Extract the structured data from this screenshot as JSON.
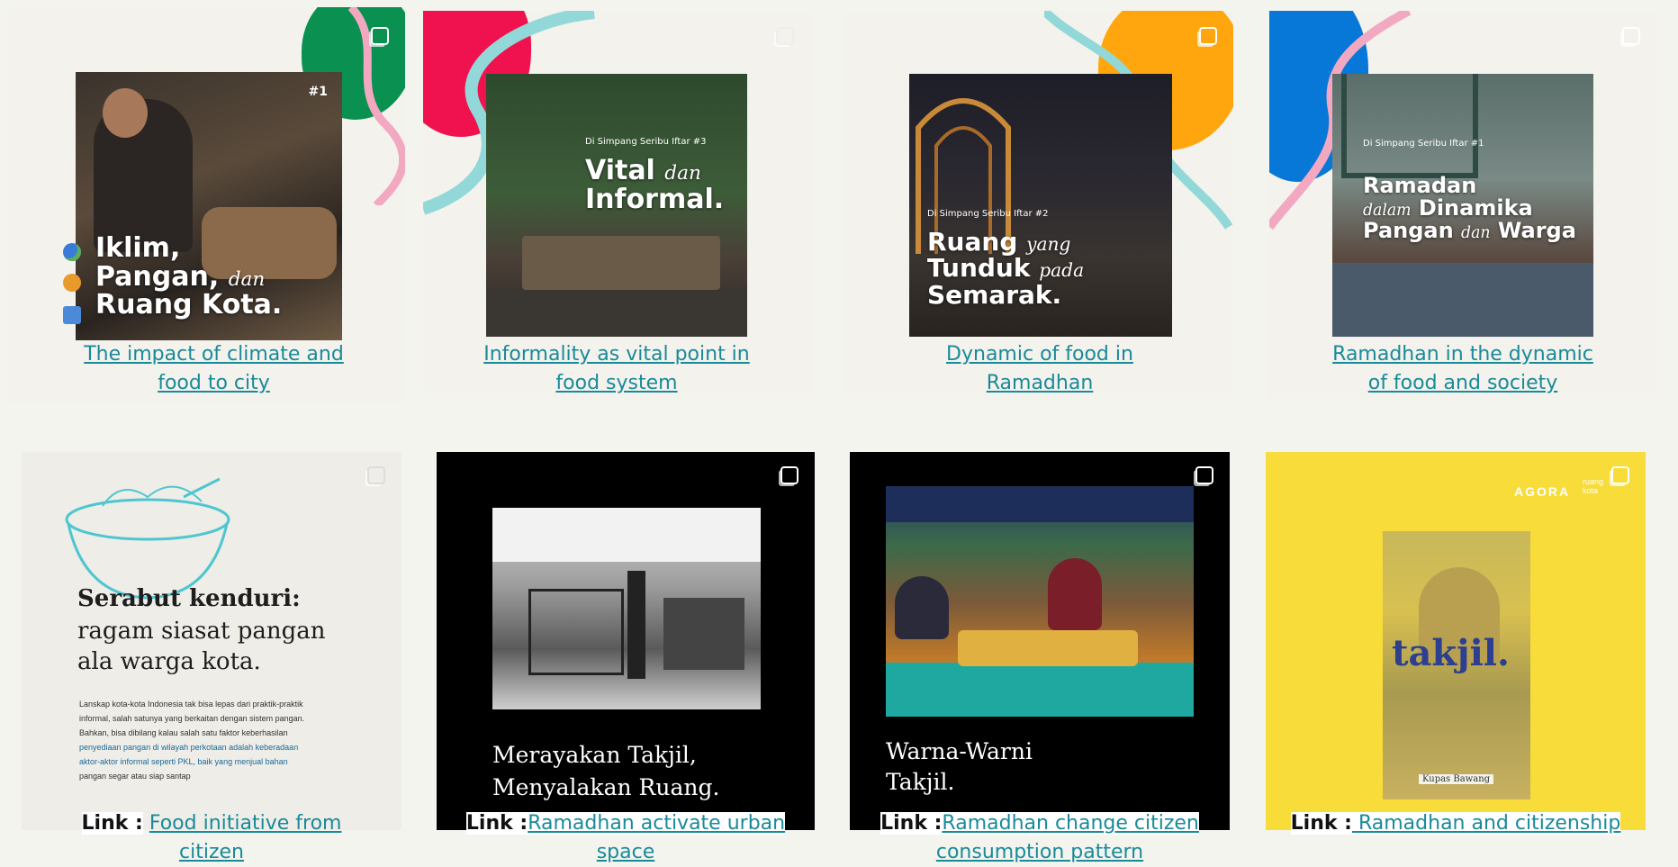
{
  "row1": [
    {
      "badge": "#1",
      "lines": [
        "Iklim,",
        "Pangan,",
        "Ruang Kota."
      ],
      "italic": "dan",
      "caption_l1": "The impact of climate and",
      "caption_l2": "food to city"
    },
    {
      "kicker": "Di Simpang Seribu Iftar #3",
      "line1": "Vital",
      "italic": "dan",
      "line2": "Informal.",
      "caption_l1": "Informality as vital point in",
      "caption_l2": "food system"
    },
    {
      "kicker": "Di Simpang Seribu Iftar #2",
      "line1": "Ruang",
      "italic1": "yang",
      "line2": "Tunduk",
      "italic2": "pada",
      "line3": "Semarak.",
      "caption_l1": "Dynamic of food  in",
      "caption_l2": "Ramadhan"
    },
    {
      "kicker": "Di Simpang Seribu Iftar #1",
      "line1": "Ramadan",
      "italic1": "dalam",
      "line2": "Dinamika",
      "line3": "Pangan",
      "italic2": "dan",
      "line4": "Warga",
      "caption_l1": "Ramadhan in the dynamic",
      "caption_l2": "of food and society"
    }
  ],
  "row2": [
    {
      "title": "Serabut kenduri:",
      "subtitle1": "ragam siasat pangan",
      "subtitle2": "ala warga kota.",
      "body": [
        "Lanskap kota-kota Indonesia tak bisa lepas dari praktik-praktik",
        "informal, salah satunya yang berkaitan dengan sistem pangan.",
        "Bahkan, bisa dibilang kalau salah satu faktor keberhasilan",
        "penyediaan pangan di wilayah perkotaan adalah keberadaan",
        "aktor-aktor informal seperti PKL, baik yang menjual bahan",
        "pangan segar atau siap santap"
      ],
      "link_label": "Link :",
      "link_l1": "Food initiative from",
      "link_l2": "citizen"
    },
    {
      "line1": "Merayakan Takjil,",
      "line2": "Menyalakan Ruang.",
      "link_label": "Link :",
      "link_l1": "Ramadhan activate urban",
      "link_l2": "space"
    },
    {
      "line1": "Warna-Warni",
      "line2": "Takjil.",
      "link_label": "Link :",
      "link_l1": "Ramadhan change citizen",
      "link_l2": "consumption pattern"
    },
    {
      "brand": "AGORA",
      "brand2": "ruang kota",
      "title": "takjil.",
      "tag": "Kupas Bawang",
      "link_label": "Link :",
      "link_l1": " Ramadhan and citizenship"
    }
  ],
  "colors": {
    "link": "#1a8a99",
    "green_blob": "#0a9050",
    "red_blob": "#f0124f",
    "orange_blob": "#ffa60f",
    "blue_blob": "#0878d8",
    "teal_stroke": "#92d8d8",
    "pink_stroke": "#f2a8c0",
    "yellow_card": "#f8dc3a"
  }
}
